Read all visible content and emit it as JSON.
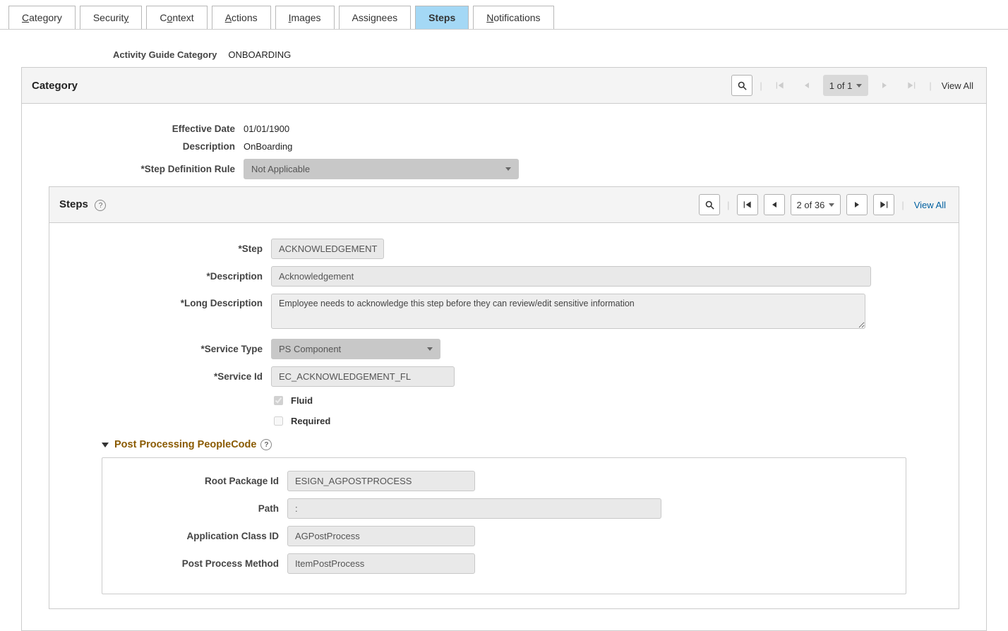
{
  "tabs": {
    "category": "Category",
    "security": "Security",
    "context": "Context",
    "actions": "Actions",
    "images": "Images",
    "assignees": "Assignees",
    "steps": "Steps",
    "notifications": "Notifications"
  },
  "header": {
    "label": "Activity Guide Category",
    "value": "ONBOARDING"
  },
  "category_panel": {
    "title": "Category",
    "nav": {
      "counter": "1 of 1",
      "viewall": "View All"
    },
    "effective_date": {
      "label": "Effective Date",
      "value": "01/01/1900"
    },
    "description": {
      "label": "Description",
      "value": "OnBoarding"
    },
    "step_rule": {
      "label": "*Step Definition Rule",
      "value": "Not Applicable"
    }
  },
  "steps_panel": {
    "title": "Steps",
    "nav": {
      "counter": "2 of 36",
      "viewall": "View All"
    },
    "step": {
      "label": "*Step",
      "value": "ACKNOWLEDGEMENT"
    },
    "description": {
      "label": "*Description",
      "value": "Acknowledgement"
    },
    "long_desc": {
      "label": "*Long Description",
      "value": "Employee needs to acknowledge this step before they can review/edit sensitive information"
    },
    "service_type": {
      "label": "*Service Type",
      "value": "PS Component"
    },
    "service_id": {
      "label": "*Service Id",
      "value": "EC_ACKNOWLEDGEMENT_FL"
    },
    "fluid_label": "Fluid",
    "required_label": "Required"
  },
  "ppc": {
    "title": "Post Processing PeopleCode",
    "root_pkg": {
      "label": "Root Package Id",
      "value": "ESIGN_AGPOSTPROCESS"
    },
    "path": {
      "label": "Path",
      "value": ":"
    },
    "app_class": {
      "label": "Application Class ID",
      "value": "AGPostProcess"
    },
    "method": {
      "label": "Post Process Method",
      "value": "ItemPostProcess"
    }
  }
}
